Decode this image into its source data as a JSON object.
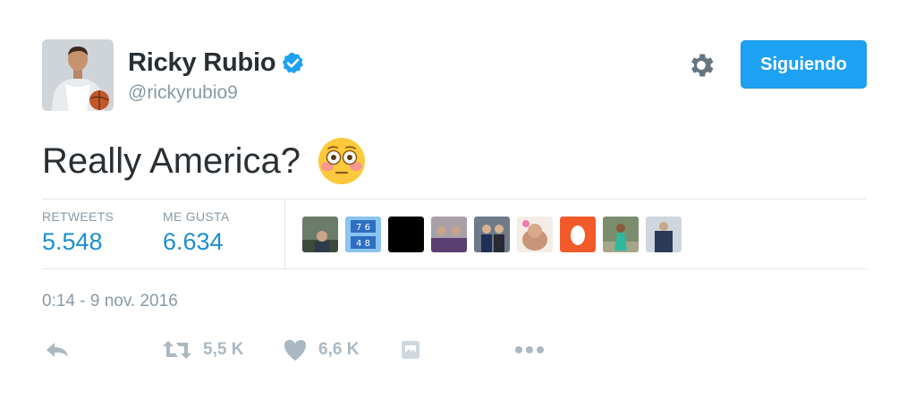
{
  "profile": {
    "display_name": "Ricky Rubio",
    "handle": "@rickyrubio9",
    "avatar_icon": "player-avatar",
    "verified_icon": "verified-badge-icon"
  },
  "header": {
    "follow_label": "Siguiendo",
    "settings_icon": "gear-icon"
  },
  "tweet": {
    "text": "Really America?",
    "emoji": "flushed-face-emoji"
  },
  "stats": {
    "retweets_label": "RETWEETS",
    "retweets_value": "5.548",
    "likes_label": "ME GUSTA",
    "likes_value": "6.634"
  },
  "likers": [
    {
      "name": "liker-avatar-1",
      "color": "#6b7c6a"
    },
    {
      "name": "liker-avatar-2",
      "color": "#4a90d9"
    },
    {
      "name": "liker-avatar-3",
      "color": "#000000"
    },
    {
      "name": "liker-avatar-4",
      "color": "#8a7f86"
    },
    {
      "name": "liker-avatar-5",
      "color": "#55606e"
    },
    {
      "name": "liker-avatar-6",
      "color": "#e8c7b0"
    },
    {
      "name": "liker-avatar-7",
      "color": "#f25a29"
    },
    {
      "name": "liker-avatar-8",
      "color": "#7a8e6e"
    },
    {
      "name": "liker-avatar-9",
      "color": "#9aa2ad"
    }
  ],
  "timestamp": "0:14 - 9 nov. 2016",
  "actions": {
    "reply_icon": "reply-icon",
    "retweet_icon": "retweet-icon",
    "retweet_count": "5,5 K",
    "like_icon": "heart-icon",
    "like_count": "6,6 K",
    "media_icon": "media-icon",
    "more_icon": "more-icon"
  },
  "colors": {
    "accent": "#1da1f2",
    "stat_value": "#1b8fcf",
    "muted": "#8899a6",
    "action_gray": "#aab8c2"
  }
}
